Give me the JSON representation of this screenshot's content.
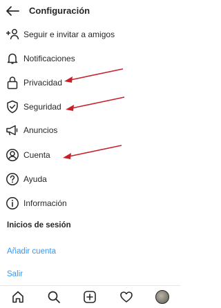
{
  "header": {
    "title": "Configuración"
  },
  "menu": {
    "items": [
      {
        "label": "Seguir e invitar a amigos",
        "icon": "add-user-icon"
      },
      {
        "label": "Notificaciones",
        "icon": "bell-icon"
      },
      {
        "label": "Privacidad",
        "icon": "lock-icon"
      },
      {
        "label": "Seguridad",
        "icon": "shield-check-icon"
      },
      {
        "label": "Anuncios",
        "icon": "megaphone-icon"
      },
      {
        "label": "Cuenta",
        "icon": "account-icon"
      },
      {
        "label": "Ayuda",
        "icon": "help-icon"
      },
      {
        "label": "Información",
        "icon": "info-icon"
      }
    ]
  },
  "logins": {
    "title": "Inicios de sesión",
    "add_account": "Añadir cuenta",
    "logout": "Salir"
  },
  "colors": {
    "link": "#3897f0",
    "annotation_arrow": "#c8202a"
  },
  "tabbar": {
    "icons": [
      "home-icon",
      "search-icon",
      "new-post-icon",
      "heart-icon",
      "profile-avatar"
    ]
  }
}
